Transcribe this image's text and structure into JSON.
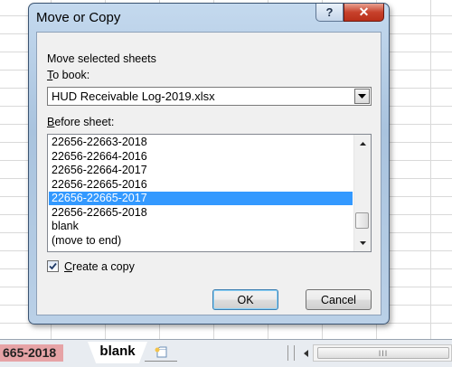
{
  "dialog": {
    "title": "Move or Copy",
    "help_glyph": "?",
    "close_glyph": "✕",
    "move_label": "Move selected sheets",
    "to_book_label": "To book:",
    "to_book_value": "HUD Receivable Log-2019.xlsx",
    "before_sheet_label": "Before sheet:",
    "sheets": [
      "22656-22663-2018",
      "22656-22664-2016",
      "22656-22664-2017",
      "22656-22665-2016",
      "22656-22665-2017",
      "22656-22665-2018",
      "blank",
      "(move to end)"
    ],
    "selected_sheet": "22656-22665-2017",
    "create_copy_label": "Create a copy",
    "create_copy_checked": true,
    "ok_label": "OK",
    "cancel_label": "Cancel"
  },
  "tabbar": {
    "prev_tab": "665-2018",
    "active_tab": "blank",
    "scroll_grip": "III"
  },
  "icons": {
    "dropdown": "chevron-down-icon",
    "checkmark": "checkmark-icon",
    "new_sheet": "new-sheet-icon",
    "scroll_left": "scroll-left-icon"
  },
  "colors": {
    "selection": "#3399ff",
    "close_button": "#c7412b",
    "prev_tab": "#e6a3a6"
  }
}
